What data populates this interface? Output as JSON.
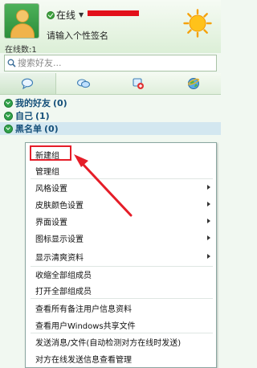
{
  "header": {
    "status_label": "在线",
    "signature_placeholder": "请输入个性签名",
    "online_count": "在线数:1"
  },
  "search": {
    "placeholder": "搜索好友..."
  },
  "tabs": [
    {
      "icon": "chat-bubble-icon"
    },
    {
      "icon": "messages-icon"
    },
    {
      "icon": "contacts-icon"
    },
    {
      "icon": "globe-icon"
    }
  ],
  "groups": [
    {
      "name": "我的好友",
      "count": "(0)"
    },
    {
      "name": "自己",
      "count": "(1)"
    },
    {
      "name": "黑名单",
      "count": "(0)"
    }
  ],
  "menu": {
    "items": [
      {
        "label": "新建组",
        "submenu": false
      },
      {
        "label": "管理组",
        "submenu": false
      },
      {
        "label": "风格设置",
        "submenu": true
      },
      {
        "label": "皮肤颜色设置",
        "submenu": true
      },
      {
        "label": "界面设置",
        "submenu": true
      },
      {
        "label": "图标显示设置",
        "submenu": true
      },
      {
        "label": "显示清爽资料",
        "submenu": true
      },
      {
        "label": "收缩全部组成员",
        "submenu": false
      },
      {
        "label": "打开全部组成员",
        "submenu": false
      },
      {
        "label": "查看所有备注用户信息资料",
        "submenu": false
      },
      {
        "label": "查看用户Windows共享文件",
        "submenu": false
      },
      {
        "label": "发送消息/文件(自动检测对方在线时发送)",
        "submenu": false
      },
      {
        "label": "对方在线发送信息查看管理",
        "submenu": false
      }
    ]
  },
  "colors": {
    "accent_green": "#31a34a",
    "annotation_red": "#e51d28",
    "selected_row": "#d3e7f0"
  }
}
